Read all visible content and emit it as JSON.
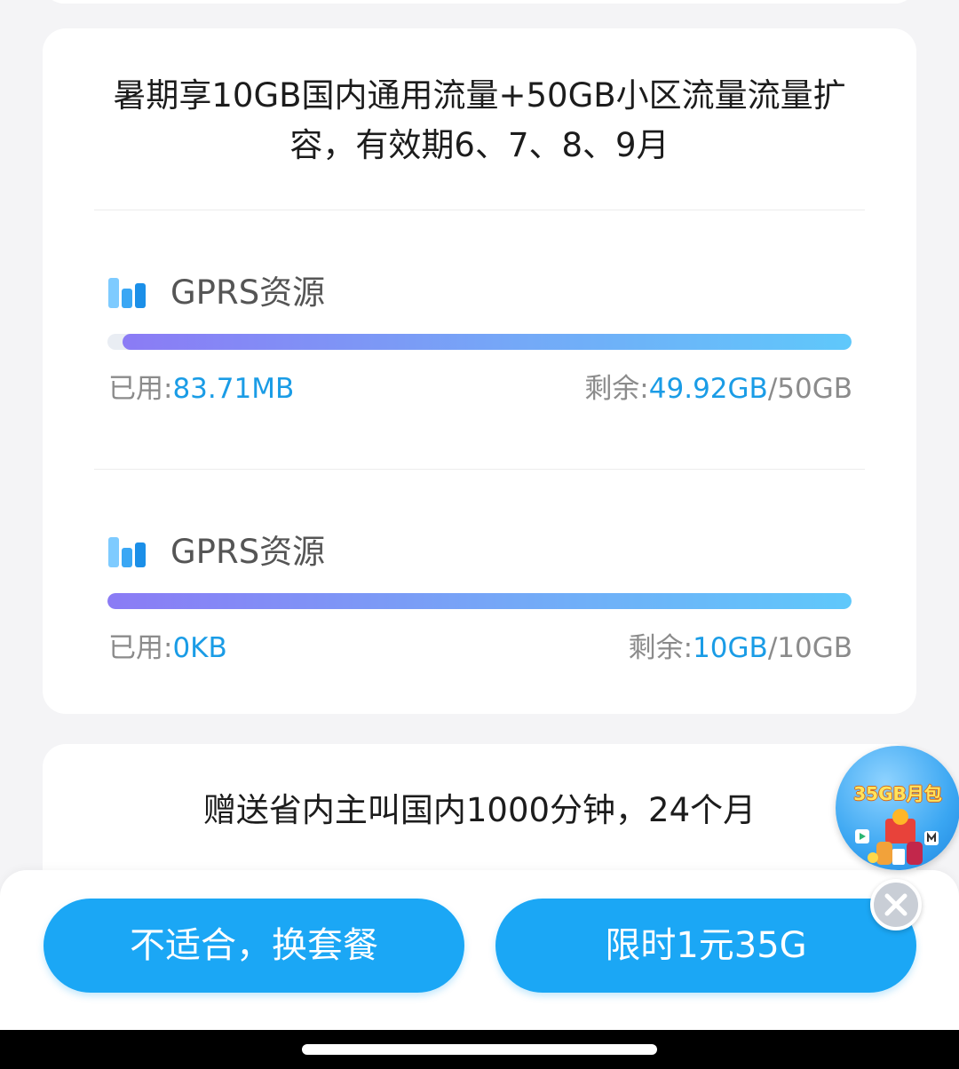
{
  "plan_card": {
    "title": "暑期享10GB国内通用流量+50GB小区流量流量扩容，有效期6、7、8、9月",
    "resources": [
      {
        "name": "GPRS资源",
        "icon": "bar-chart-icon",
        "used_label": "已用:",
        "used_value": "83.71MB",
        "remaining_label": "剩余:",
        "remaining_value": "49.92GB",
        "total": "/50GB",
        "remaining_fraction": 0.9984
      },
      {
        "name": "GPRS资源",
        "icon": "bar-chart-icon",
        "used_label": "已用:",
        "used_value": "0KB",
        "remaining_label": "剩余:",
        "remaining_value": "10GB",
        "total": "/10GB",
        "remaining_fraction": 1.0
      }
    ]
  },
  "minutes_card": {
    "title": "赠送省内主叫国内1000分钟，24个月"
  },
  "promo_badge": {
    "label": "35GB月包",
    "icon": "gift-promo-icon"
  },
  "bottom_bar": {
    "switch_plan_label": "不适合，换套餐",
    "offer_label": "限时1元35G"
  },
  "colors": {
    "accent": "#1ba7f5",
    "value_blue": "#1a9ce6",
    "bar_start": "#8b7bf5",
    "bar_end": "#5fc8fb"
  }
}
